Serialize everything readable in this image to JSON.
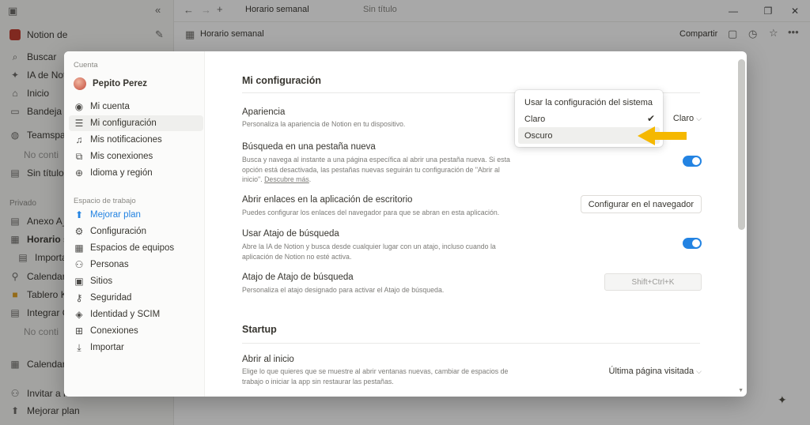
{
  "sidebar": {
    "workspace": "Notion de",
    "items": [
      {
        "icon": "search-icon",
        "glyph": "⌕",
        "label": "Buscar"
      },
      {
        "icon": "ai-icon",
        "glyph": "✦",
        "label": "IA de Notion"
      },
      {
        "icon": "home-icon",
        "glyph": "⌂",
        "label": "Inicio"
      },
      {
        "icon": "inbox-icon",
        "glyph": "▭",
        "label": "Bandeja de"
      }
    ],
    "teamspace": "Teamspa",
    "teamspace_empty": "No conti",
    "untitled": "Sin título",
    "section_private": "Privado",
    "private_items": [
      "Anexo A_",
      "Horario se",
      "Importa",
      "Calendari",
      "Tablero K",
      "Integrar C"
    ],
    "private_empty": "No conti",
    "calendar": "Calendari",
    "invite": "Invitar a m",
    "upgrade": "Mejorar plan"
  },
  "titlebar": {
    "tab_title": "Horario semanal",
    "tab_subtitle": "Sin título",
    "breadcrumb": "Horario semanal",
    "share": "Compartir"
  },
  "modal": {
    "account_section": "Cuenta",
    "user_name": "Pepito Perez",
    "account_items": [
      {
        "icon": "user-circle-icon",
        "glyph": "◉",
        "label": "Mi cuenta"
      },
      {
        "icon": "sliders-icon",
        "glyph": "☰",
        "label": "Mi configuración",
        "active": true
      },
      {
        "icon": "bell-icon",
        "glyph": "🔔︎",
        "label": "Mis notificaciones"
      },
      {
        "icon": "connections-icon",
        "glyph": "⧉",
        "label": "Mis conexiones"
      },
      {
        "icon": "globe-icon",
        "glyph": "⊕",
        "label": "Idioma y región"
      }
    ],
    "workspace_section": "Espacio de trabajo",
    "workspace_items": [
      {
        "icon": "upgrade-icon",
        "glyph": "⬆",
        "label": "Mejorar plan",
        "accent": true
      },
      {
        "icon": "gear-icon",
        "glyph": "⚙",
        "label": "Configuración"
      },
      {
        "icon": "building-icon",
        "glyph": "▦",
        "label": "Espacios de equipos"
      },
      {
        "icon": "people-icon",
        "glyph": "⚇",
        "label": "Personas"
      },
      {
        "icon": "sites-icon",
        "glyph": "▣",
        "label": "Sitios"
      },
      {
        "icon": "key-icon",
        "glyph": "⚷",
        "label": "Seguridad"
      },
      {
        "icon": "shield-icon",
        "glyph": "◈",
        "label": "Identidad y SCIM"
      },
      {
        "icon": "grid-icon",
        "glyph": "⊞",
        "label": "Conexiones"
      },
      {
        "icon": "download-icon",
        "glyph": "⤓",
        "label": "Importar"
      }
    ],
    "heading": "Mi configuración",
    "appearance": {
      "title": "Apariencia",
      "desc": "Personaliza la apariencia de Notion en tu dispositivo.",
      "value": "Claro"
    },
    "new_tab_search": {
      "title": "Búsqueda en una pestaña nueva",
      "desc": "Busca y navega al instante a una página específica al abrir una pestaña nueva. Si esta opción está desactivada, las pestañas nuevas seguirán tu configuración de \"Abrir al inicio\".",
      "link": "Descubre más"
    },
    "desktop_links": {
      "title": "Abrir enlaces en la aplicación de escritorio",
      "desc": "Puedes configurar los enlaces del navegador para que se abran en esta aplicación.",
      "button": "Configurar en el navegador"
    },
    "search_shortcut": {
      "title": "Usar Atajo de búsqueda",
      "desc": "Abre la IA de Notion y busca desde cualquier lugar con un atajo, incluso cuando la aplicación de Notion no esté activa."
    },
    "shortcut_key": {
      "title": "Atajo de Atajo de búsqueda",
      "desc": "Personaliza el atajo designado para activar el Atajo de búsqueda.",
      "value": "Shift+Ctrl+K"
    },
    "startup_heading": "Startup",
    "open_on_start": {
      "title": "Abrir al inicio",
      "desc": "Elige lo que quieres que se muestre al abrir ventanas nuevas, cambiar de espacios de trabajo o iniciar la app sin restaurar las pestañas.",
      "value": "Última página visitada"
    }
  },
  "dropdown": {
    "options": [
      "Usar la configuración del sistema",
      "Claro",
      "Oscuro"
    ],
    "selected": "Claro",
    "hovered": "Oscuro"
  },
  "colors": {
    "accent": "#2383e2",
    "arrow": "#f5b800"
  }
}
